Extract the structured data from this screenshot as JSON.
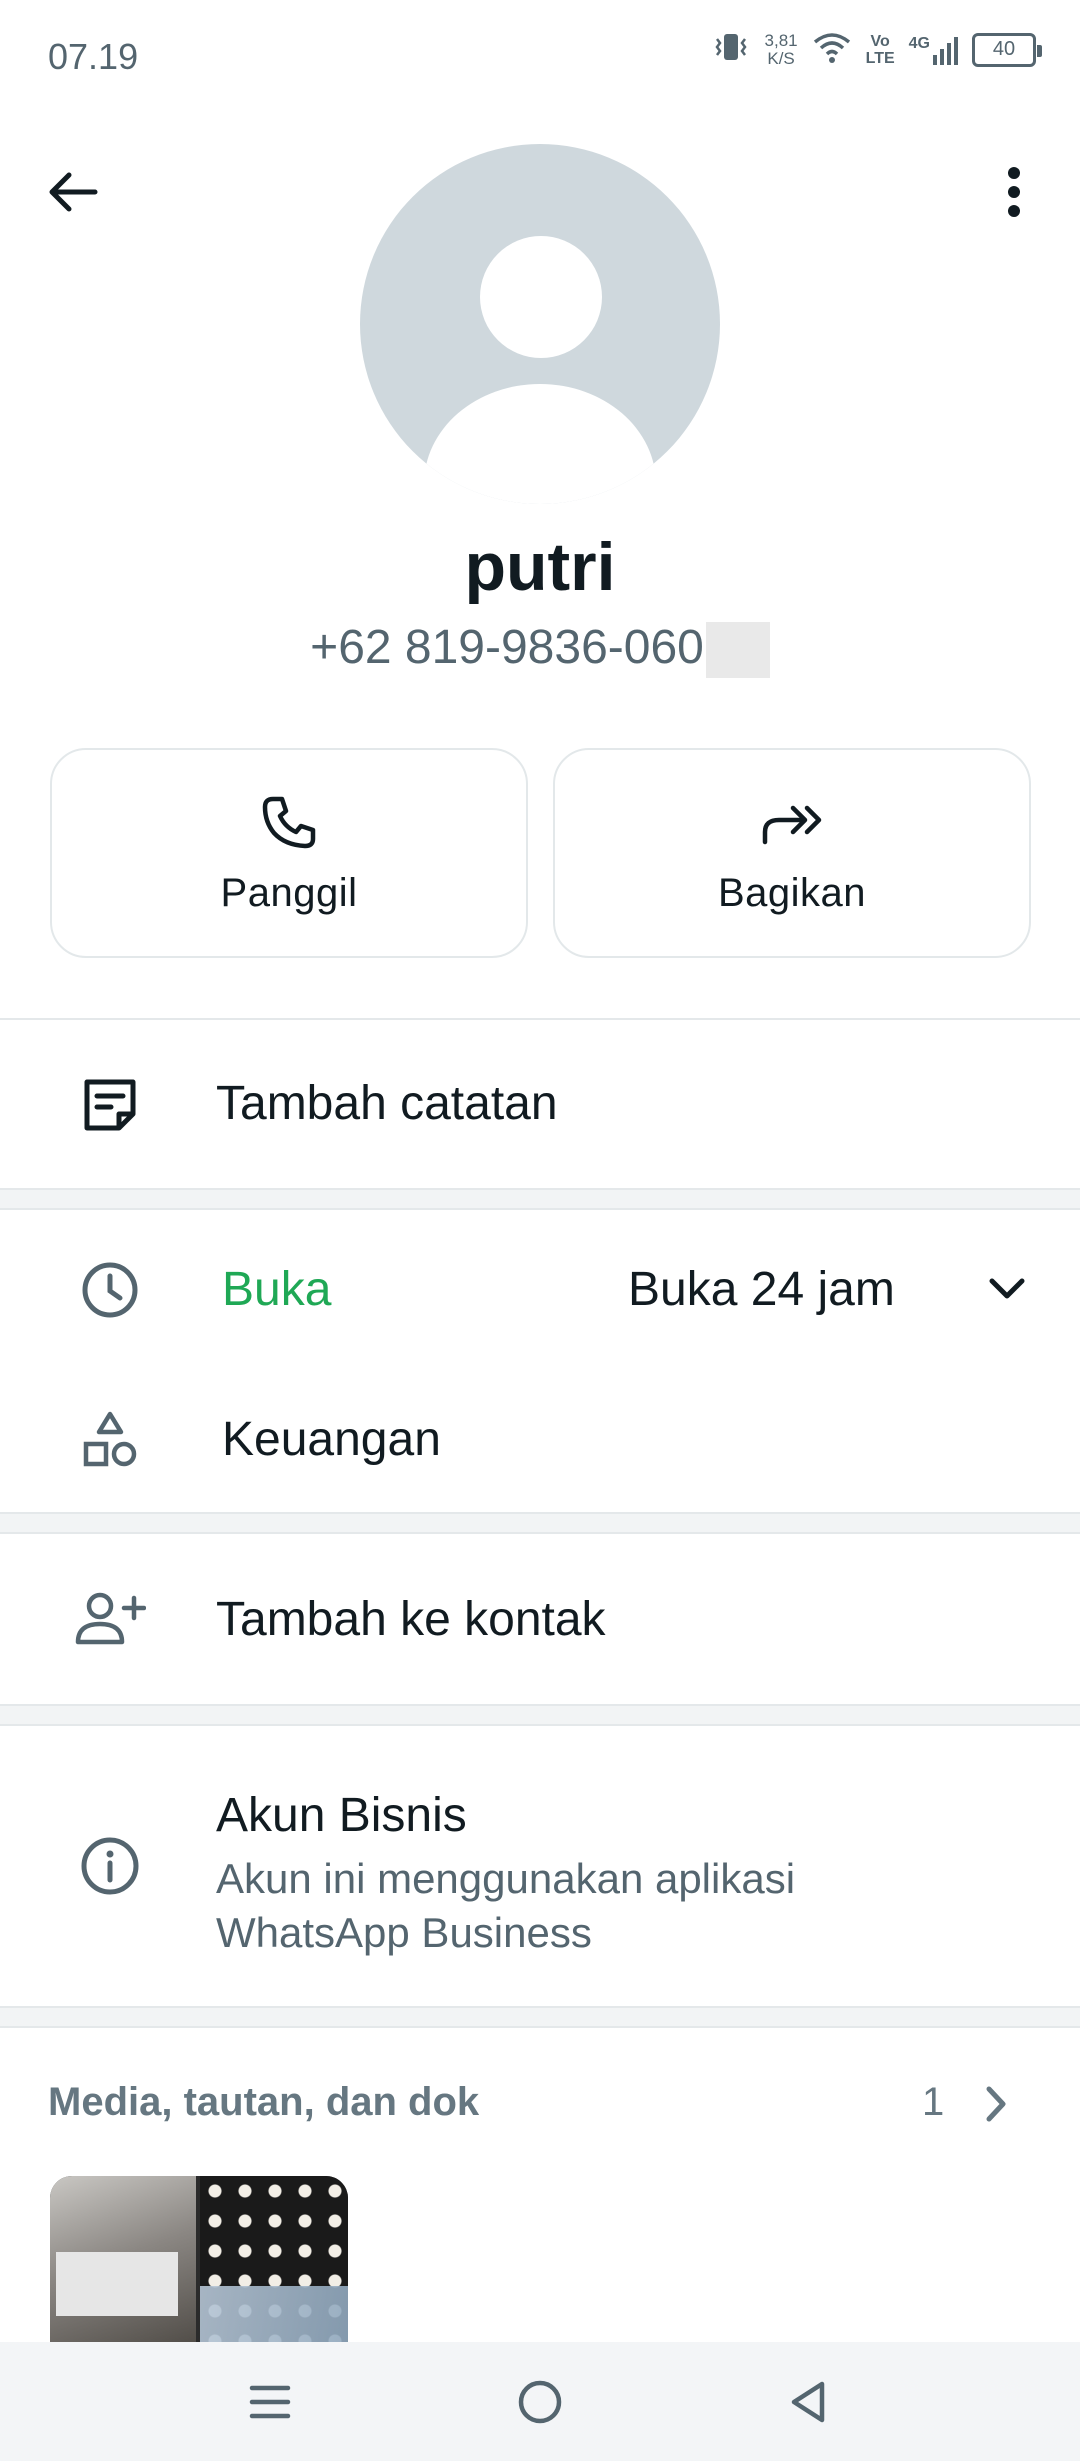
{
  "status_bar": {
    "time": "07.19",
    "net_speed_value": "3,81",
    "net_speed_unit": "K/S",
    "volte_top": "Vo",
    "volte_bottom": "LTE",
    "network": "4G",
    "battery": "40"
  },
  "contact": {
    "name": "putri",
    "phone": "+62 819-9836-060"
  },
  "actions": {
    "call_label": "Panggil",
    "share_label": "Bagikan"
  },
  "notes": {
    "label": "Tambah catatan"
  },
  "business_hours": {
    "status": "Buka",
    "hours": "Buka 24 jam",
    "status_color": "#1fa855"
  },
  "category": {
    "label": "Keuangan"
  },
  "add_contact": {
    "label": "Tambah ke kontak"
  },
  "business_account": {
    "title": "Akun Bisnis",
    "subtitle": "Akun ini menggunakan aplikasi WhatsApp Business"
  },
  "media": {
    "label": "Media, tautan, dan dok",
    "count": "1"
  },
  "icons": [
    "back-arrow-icon",
    "more-vert-icon",
    "phone-icon",
    "share-forward-icon",
    "note-icon",
    "clock-icon",
    "chevron-down-icon",
    "shapes-icon",
    "add-person-icon",
    "info-icon",
    "chevron-right-icon",
    "menu-icon",
    "home-circle-icon",
    "back-triangle-icon"
  ]
}
